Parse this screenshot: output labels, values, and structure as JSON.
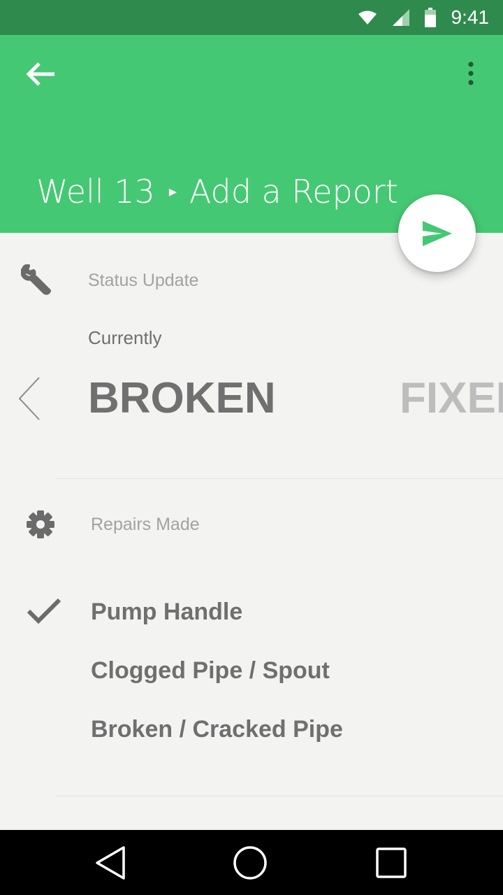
{
  "status_bar": {
    "time": "9:41"
  },
  "app_bar": {
    "title_parent": "Well 13",
    "title_separator": "▸",
    "title_current": "Add a Report"
  },
  "status_section": {
    "label": "Status Update",
    "current_label": "Currently",
    "options": [
      "BROKEN",
      "FIXED"
    ],
    "selected": "BROKEN"
  },
  "repairs_section": {
    "label": "Repairs Made",
    "items": [
      {
        "label": "Pump Handle",
        "checked": true
      },
      {
        "label": "Clogged Pipe / Spout",
        "checked": false
      },
      {
        "label": "Broken / Cracked Pipe",
        "checked": false
      }
    ]
  },
  "colors": {
    "primary": "#45c873",
    "primary_dark": "#2f8a4d",
    "background": "#f3f3f2",
    "accent_icon": "#45c873"
  },
  "icons": {
    "back": "arrow-left-icon",
    "overflow": "more-vert-icon",
    "send": "send-icon",
    "status": "wrench-icon",
    "repairs": "gear-icon",
    "check": "check-icon"
  }
}
